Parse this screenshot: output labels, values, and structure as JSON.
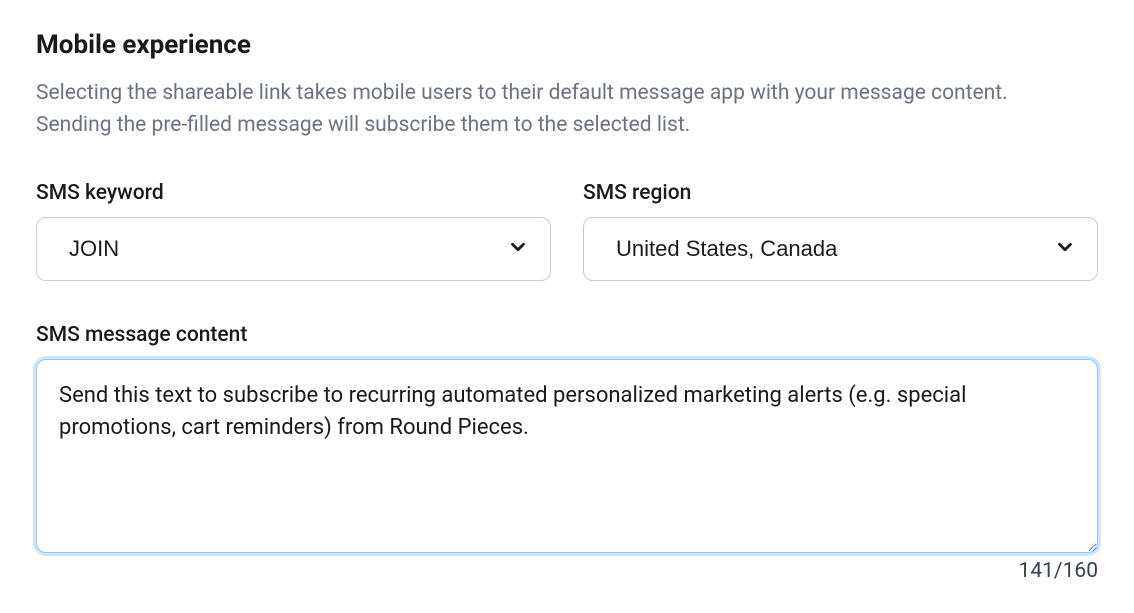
{
  "section": {
    "title": "Mobile experience",
    "description": "Selecting the shareable link takes mobile users to their default message app with your message content. Sending the pre-filled message will subscribe them to the selected list."
  },
  "fields": {
    "sms_keyword": {
      "label": "SMS keyword",
      "value": "JOIN"
    },
    "sms_region": {
      "label": "SMS region",
      "value": "United States, Canada"
    },
    "sms_message": {
      "label": "SMS message content",
      "value": "Send this text to subscribe to recurring automated personalized marketing alerts (e.g. special promotions, cart reminders) from Round Pieces.",
      "counter": "141/160"
    }
  }
}
